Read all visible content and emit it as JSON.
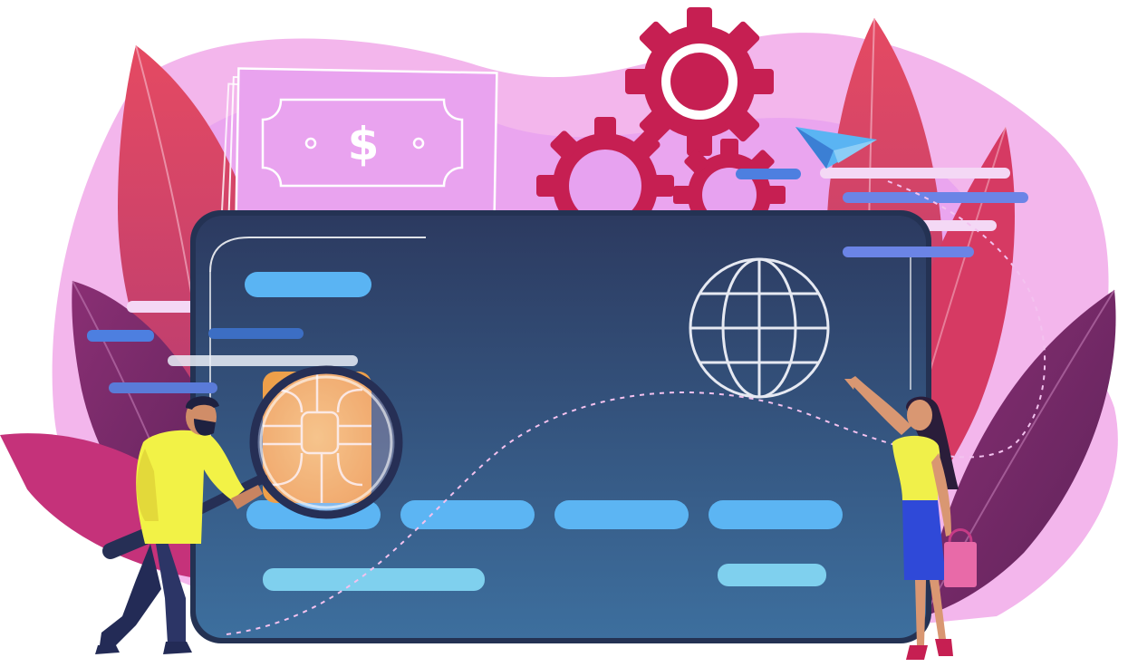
{
  "banknote": {
    "symbol": "$"
  },
  "colors": {
    "background": "#ffffff",
    "blob_pink": "#f2b4ea",
    "blob_violet": "#e79cf0",
    "leaf_red": "#e0475f",
    "leaf_purple": "#7a2a67",
    "card_top": "#2f3f66",
    "card_bottom": "#3b6c9b",
    "card_bar": "#5cb4f2",
    "gear": "#c61f52",
    "chip": "#f3b25a",
    "shirt": "#f2f246",
    "skirt": "#2f49d8",
    "pants": "#232b56"
  },
  "icons": [
    "banknote-icon",
    "gear-icon",
    "globe-icon",
    "card-chip-icon",
    "magnifying-glass-icon",
    "paper-plane-icon",
    "shopping-bag-icon"
  ]
}
